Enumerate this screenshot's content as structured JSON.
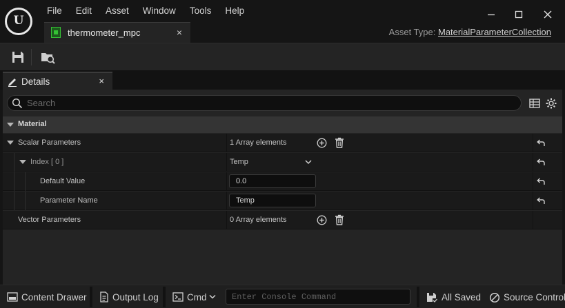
{
  "app": {
    "menu": [
      "File",
      "Edit",
      "Asset",
      "Window",
      "Tools",
      "Help"
    ],
    "asset_tab": {
      "label": "thermometer_mpc",
      "close": "×"
    },
    "asset_type": {
      "label": "Asset Type:",
      "value": "MaterialParameterCollection"
    },
    "window_controls": {
      "minimize": "—",
      "maximize": "☐",
      "close": "✕"
    }
  },
  "toolbar": {
    "icons": [
      "save-icon",
      "browse-asset-icon"
    ]
  },
  "details": {
    "tab_label": "Details",
    "tab_close": "×",
    "search": {
      "placeholder": "Search",
      "value": ""
    },
    "category": "Material",
    "rows": {
      "scalar": {
        "name": "Scalar Parameters",
        "value": "1 Array elements"
      },
      "index": {
        "name": "Index [ 0 ]",
        "value": "Temp"
      },
      "default_value": {
        "name": "Default Value",
        "value": "0.0"
      },
      "parameter_name": {
        "name": "Parameter Name",
        "value": "Temp"
      },
      "vector": {
        "name": "Vector Parameters",
        "value": "0 Array elements"
      }
    }
  },
  "statusbar": {
    "content_drawer": "Content Drawer",
    "output_log": "Output Log",
    "cmd": "Cmd",
    "console_placeholder": "Enter Console Command",
    "all_saved": "All Saved",
    "source_control": "Source Control"
  },
  "colors": {
    "background": "#151515",
    "panel": "#242424",
    "row": "#1a1a1a",
    "category": "#343434",
    "asset_icon": "#35c335"
  }
}
